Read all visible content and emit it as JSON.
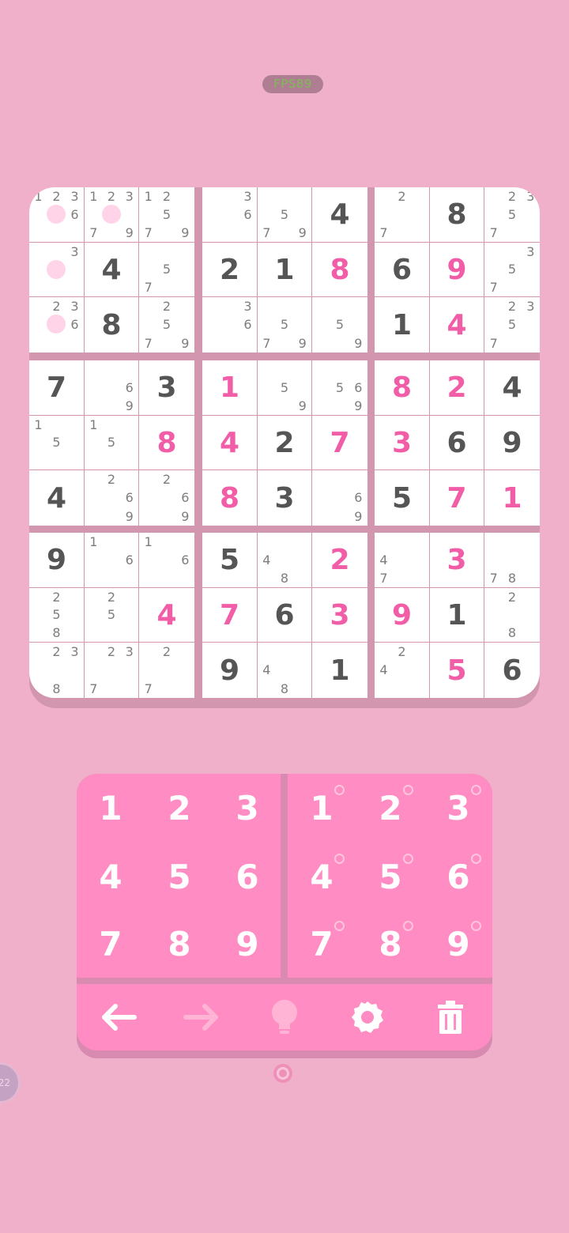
{
  "fps": "FPS89",
  "board": {
    "rows": [
      [
        {
          "notes": [
            1,
            2,
            3,
            6
          ],
          "dot": true
        },
        {
          "notes": [
            1,
            2,
            3,
            7,
            9
          ],
          "dot": true
        },
        {
          "notes": [
            1,
            2,
            5,
            7,
            9
          ]
        },
        {
          "notes": [
            3,
            6
          ]
        },
        {
          "notes": [
            5,
            7,
            9
          ]
        },
        {
          "value": "4",
          "kind": "given"
        },
        {
          "notes": [
            2,
            7
          ]
        },
        {
          "value": "8",
          "kind": "given"
        },
        {
          "notes": [
            2,
            3,
            5,
            7
          ]
        }
      ],
      [
        {
          "notes": [
            3
          ],
          "dot": true
        },
        {
          "value": "4",
          "kind": "given"
        },
        {
          "notes": [
            5,
            7
          ]
        },
        {
          "value": "2",
          "kind": "given"
        },
        {
          "value": "1",
          "kind": "given"
        },
        {
          "value": "8",
          "kind": "user"
        },
        {
          "value": "6",
          "kind": "given"
        },
        {
          "value": "9",
          "kind": "user"
        },
        {
          "notes": [
            3,
            5,
            7
          ]
        }
      ],
      [
        {
          "notes": [
            2,
            3,
            6
          ],
          "dot": true
        },
        {
          "value": "8",
          "kind": "given"
        },
        {
          "notes": [
            2,
            5,
            7,
            9
          ]
        },
        {
          "notes": [
            3,
            6
          ]
        },
        {
          "notes": [
            5,
            7,
            9
          ]
        },
        {
          "notes": [
            5,
            9
          ]
        },
        {
          "value": "1",
          "kind": "given"
        },
        {
          "value": "4",
          "kind": "user"
        },
        {
          "notes": [
            2,
            3,
            5,
            7
          ]
        }
      ],
      [
        {
          "value": "7",
          "kind": "given"
        },
        {
          "notes": [
            6,
            9
          ]
        },
        {
          "value": "3",
          "kind": "given"
        },
        {
          "value": "1",
          "kind": "user"
        },
        {
          "notes": [
            5,
            9
          ]
        },
        {
          "notes": [
            5,
            6,
            9
          ]
        },
        {
          "value": "8",
          "kind": "user"
        },
        {
          "value": "2",
          "kind": "user"
        },
        {
          "value": "4",
          "kind": "given"
        }
      ],
      [
        {
          "notes": [
            1,
            5
          ]
        },
        {
          "notes": [
            1,
            5
          ]
        },
        {
          "value": "8",
          "kind": "user"
        },
        {
          "value": "4",
          "kind": "user"
        },
        {
          "value": "2",
          "kind": "given"
        },
        {
          "value": "7",
          "kind": "user"
        },
        {
          "value": "3",
          "kind": "user"
        },
        {
          "value": "6",
          "kind": "given"
        },
        {
          "value": "9",
          "kind": "given"
        }
      ],
      [
        {
          "value": "4",
          "kind": "given"
        },
        {
          "notes": [
            2,
            6,
            9
          ]
        },
        {
          "notes": [
            2,
            6,
            9
          ]
        },
        {
          "value": "8",
          "kind": "user"
        },
        {
          "value": "3",
          "kind": "given"
        },
        {
          "notes": [
            6,
            9
          ]
        },
        {
          "value": "5",
          "kind": "given"
        },
        {
          "value": "7",
          "kind": "user"
        },
        {
          "value": "1",
          "kind": "user"
        }
      ],
      [
        {
          "value": "9",
          "kind": "given"
        },
        {
          "notes": [
            1,
            6
          ]
        },
        {
          "notes": [
            1,
            6
          ]
        },
        {
          "value": "5",
          "kind": "given"
        },
        {
          "notes": [
            4,
            8
          ]
        },
        {
          "value": "2",
          "kind": "user"
        },
        {
          "notes": [
            4,
            7
          ]
        },
        {
          "value": "3",
          "kind": "user"
        },
        {
          "notes": [
            7,
            8
          ]
        }
      ],
      [
        {
          "notes": [
            2,
            5,
            8
          ]
        },
        {
          "notes": [
            2,
            5
          ]
        },
        {
          "value": "4",
          "kind": "user"
        },
        {
          "value": "7",
          "kind": "user"
        },
        {
          "value": "6",
          "kind": "given"
        },
        {
          "value": "3",
          "kind": "user"
        },
        {
          "value": "9",
          "kind": "user"
        },
        {
          "value": "1",
          "kind": "given"
        },
        {
          "notes": [
            2,
            8
          ]
        }
      ],
      [
        {
          "notes": [
            2,
            3,
            8
          ]
        },
        {
          "notes": [
            2,
            3,
            7
          ]
        },
        {
          "notes": [
            2,
            7
          ]
        },
        {
          "value": "9",
          "kind": "given"
        },
        {
          "notes": [
            4,
            8
          ]
        },
        {
          "value": "1",
          "kind": "given"
        },
        {
          "notes": [
            2,
            4
          ]
        },
        {
          "value": "5",
          "kind": "user"
        },
        {
          "value": "6",
          "kind": "given"
        }
      ]
    ]
  },
  "numpad": {
    "digits": [
      "1",
      "2",
      "3",
      "4",
      "5",
      "6",
      "7",
      "8",
      "9"
    ],
    "note_digits": [
      "1",
      "2",
      "3",
      "4",
      "5",
      "6",
      "7",
      "8",
      "9"
    ]
  },
  "toolbar": {
    "tools": [
      {
        "name": "undo",
        "icon": "arrow-left-icon",
        "enabled": true
      },
      {
        "name": "redo",
        "icon": "arrow-right-icon",
        "enabled": false
      },
      {
        "name": "hint",
        "icon": "lightbulb-icon",
        "enabled": false
      },
      {
        "name": "settings",
        "icon": "gear-icon",
        "enabled": true
      },
      {
        "name": "erase",
        "icon": "trash-icon",
        "enabled": true
      }
    ]
  },
  "side_badge": "22",
  "colors": {
    "background": "#f0b0ca",
    "given_digit": "#555555",
    "user_digit": "#f25da8",
    "note_digit": "#7d7d7d",
    "pad": "#ff8cc2",
    "fps_text": "#7dbd55"
  }
}
